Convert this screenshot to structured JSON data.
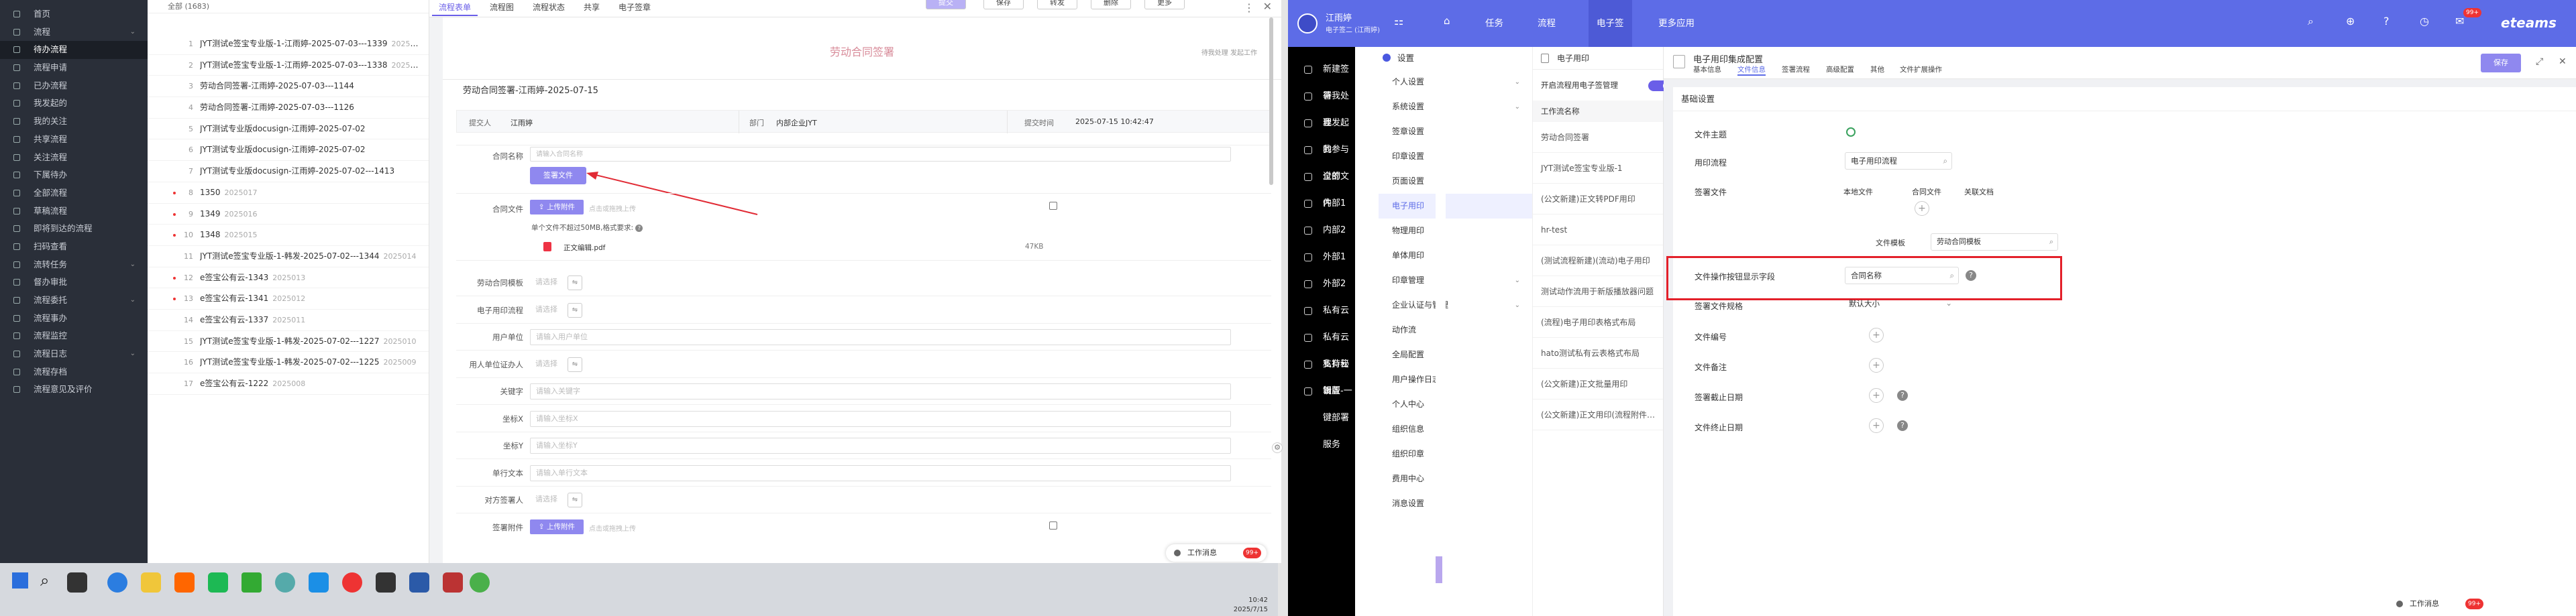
{
  "left_nav": {
    "items": [
      {
        "label": "首页",
        "active": false,
        "chev": false
      },
      {
        "label": "流程",
        "active": false,
        "chev": true
      },
      {
        "label": "待办流程",
        "active": true,
        "chev": false
      },
      {
        "label": "流程申请",
        "active": false,
        "chev": false
      },
      {
        "label": "已办流程",
        "active": false,
        "chev": false
      },
      {
        "label": "我发起的",
        "active": false,
        "chev": false
      },
      {
        "label": "我的关注",
        "active": false,
        "chev": false
      },
      {
        "label": "共享流程",
        "active": false,
        "chev": false
      },
      {
        "label": "关注流程",
        "active": false,
        "chev": false
      },
      {
        "label": "下属待办",
        "active": false,
        "chev": false
      },
      {
        "label": "全部流程",
        "active": false,
        "chev": false
      },
      {
        "label": "草稿流程",
        "active": false,
        "chev": false
      },
      {
        "label": "即将到达的流程",
        "active": false,
        "chev": false
      },
      {
        "label": "扫码查看",
        "active": false,
        "chev": false
      },
      {
        "label": "流转任务",
        "active": false,
        "chev": true
      },
      {
        "label": "督办审批",
        "active": false,
        "chev": false
      },
      {
        "label": "流程委托",
        "active": false,
        "chev": true
      },
      {
        "label": "流程事办",
        "active": false,
        "chev": false
      },
      {
        "label": "流程监控",
        "active": false,
        "chev": false
      },
      {
        "label": "流程日志",
        "active": false,
        "chev": true
      },
      {
        "label": "流程存档",
        "active": false,
        "chev": false
      },
      {
        "label": "流程意见及评价",
        "active": false,
        "chev": false
      }
    ]
  },
  "list": {
    "header": "全部 (1683)",
    "rows": [
      {
        "num": "1",
        "title": "JYT测试e签宝专业版-1-江雨婷-2025-07-03---1339",
        "tag": "2025018",
        "dot": false
      },
      {
        "num": "2",
        "title": "JYT测试e签宝专业版-1-江雨婷-2025-07-03---1338",
        "tag": "2025018",
        "dot": false
      },
      {
        "num": "3",
        "title": "劳动合同签署-江雨婷-2025-07-03---1144",
        "tag": "",
        "dot": false
      },
      {
        "num": "4",
        "title": "劳动合同签署-江雨婷-2025-07-03---1126",
        "tag": "",
        "dot": false
      },
      {
        "num": "5",
        "title": "JYT测试专业版docusign-江雨婷-2025-07-02",
        "tag": "",
        "dot": false
      },
      {
        "num": "6",
        "title": "JYT测试专业版docusign-江雨婷-2025-07-02",
        "tag": "",
        "dot": false
      },
      {
        "num": "7",
        "title": "JYT测试专业版docusign-江雨婷-2025-07-02---1413",
        "tag": "",
        "dot": false
      },
      {
        "num": "8",
        "title": "1350",
        "tag": "2025017",
        "dot": true
      },
      {
        "num": "9",
        "title": "1349",
        "tag": "2025016",
        "dot": true
      },
      {
        "num": "10",
        "title": "1348",
        "tag": "2025015",
        "dot": true
      },
      {
        "num": "11",
        "title": "JYT测试e签宝专业版-1-韩发-2025-07-02---1344",
        "tag": "2025014",
        "dot": false
      },
      {
        "num": "12",
        "title": "e签宝公有云-1343",
        "tag": "2025013",
        "dot": true
      },
      {
        "num": "13",
        "title": "e签宝公有云-1341",
        "tag": "2025012",
        "dot": true
      },
      {
        "num": "14",
        "title": "e签宝公有云-1337",
        "tag": "2025011",
        "dot": false
      },
      {
        "num": "15",
        "title": "JYT测试e签宝专业版-1-韩发-2025-07-02---1227",
        "tag": "2025010",
        "dot": false
      },
      {
        "num": "16",
        "title": "JYT测试e签宝专业版-1-韩发-2025-07-02---1225",
        "tag": "2025009",
        "dot": false
      },
      {
        "num": "17",
        "title": "e签宝公有云-1222",
        "tag": "2025008",
        "dot": false
      }
    ]
  },
  "form": {
    "tabs": [
      "流程表单",
      "流程图",
      "流程状态",
      "共享",
      "电子签章"
    ],
    "toolbar": [
      "提交",
      "保存",
      "转发",
      "删除",
      "更多"
    ],
    "main_title": "劳动合同签署",
    "sub_title": "劳动合同签署-江雨婷-2025-07-15",
    "link": "待我处理 发起工作",
    "row_labels": {
      "applicant": "提交人",
      "dept": "部门",
      "time": "提交时间"
    },
    "row_values": {
      "applicant": "江雨婷",
      "dept": "内部企业JYT",
      "time": "2025-07-15 10:42:47"
    },
    "contract_name_label": "合同名称",
    "contract_name_ph": "请输入合同名称",
    "sign_button": "签署文件",
    "contract_file_label": "合同文件",
    "upload_button": "上传附件",
    "upload_ph": "点击或拖拽上传",
    "file_limit": "单个文件不超过50MB,格式要求:",
    "file_name": "正文编辑.pdf",
    "file_size": "47KB",
    "fields": [
      {
        "label": "劳动合同模板",
        "ph": "请选择"
      },
      {
        "label": "电子用印流程",
        "ph": "请选择"
      },
      {
        "label": "用户单位",
        "ph": "请输入用户单位"
      },
      {
        "label": "用人单位证办人",
        "ph": "请选择"
      },
      {
        "label": "关键字",
        "ph": "请输入关键字"
      },
      {
        "label": "坐标X",
        "ph": "请输入坐标X"
      },
      {
        "label": "坐标Y",
        "ph": "请输入坐标Y"
      },
      {
        "label": "单行文本",
        "ph": "请输入单行文本"
      },
      {
        "label": "对方签署人",
        "ph": "请选择"
      },
      {
        "label": "签署附件",
        "ph": "点击或拖拽上传"
      }
    ],
    "work_msg": "工作消息",
    "badge": "99+"
  },
  "taskbar": {
    "time": "10:42",
    "date": "2025/7/15"
  },
  "app2": {
    "header": {
      "company": "江雨婷",
      "subtitle": "电子签二 (江雨婷)",
      "nav": [
        "任务",
        "流程",
        "电子签",
        "更多应用"
      ],
      "logo": "eteams",
      "badge": "99+"
    },
    "dark_menu": [
      "新建签署",
      "待我处理",
      "我发起的",
      "我参与过的",
      "全部文件",
      "内部1",
      "内部2",
      "外部1",
      "外部2",
      "私有云",
      "私有云支持秘钥",
      "私有云新版-一键部署服务",
      "设置"
    ],
    "settings_title": "设置",
    "settings_menu": [
      {
        "label": "个人设置",
        "chev": true
      },
      {
        "label": "系统设置",
        "chev": true
      },
      {
        "label": "签章设置",
        "chev": false
      },
      {
        "label": "印章设置",
        "chev": false
      },
      {
        "label": "页面设置",
        "chev": false
      },
      {
        "label": "电子用印",
        "chev": false,
        "active": true
      },
      {
        "label": "物理用印",
        "chev": false
      },
      {
        "label": "单体用印",
        "chev": false
      },
      {
        "label": "印章管理",
        "chev": true
      },
      {
        "label": "企业认证与管理",
        "chev": true
      },
      {
        "label": "动作流",
        "chev": false
      },
      {
        "label": "全局配置",
        "chev": false
      },
      {
        "label": "用户操作日志",
        "chev": false
      },
      {
        "label": "个人中心",
        "chev": false
      },
      {
        "label": "组织信息",
        "chev": false
      },
      {
        "label": "组织印章",
        "chev": false
      },
      {
        "label": "费用中心",
        "chev": false
      },
      {
        "label": "消息设置",
        "chev": false
      }
    ],
    "workflow_header": "电子用印",
    "toggle_label": "开启流程用电子签管理",
    "workflow_name_label": "工作流名称",
    "workflows": [
      "劳动合同签署",
      "JYT测试e签宝专业版-1",
      "(公文新建)正文转PDF用印",
      "hr-test",
      "(测试流程新建)(流动)电子用印",
      "测试动作流用于新版播放器问题",
      "(流程)电子用印表格式布局",
      "hato测试私有云表格式布局",
      "(公文新建)正文批量用印",
      "(公文新建)正文用印(流程附件转正文附件)"
    ],
    "config": {
      "title": "电子用印集成配置",
      "tabs": [
        "基本信息",
        "文件信息",
        "签署流程",
        "高级配置",
        "其他",
        "文件扩展操作"
      ],
      "save": "保存",
      "section": "基础设置",
      "file_subject_label": "文件主题",
      "flow_label": "用印流程",
      "flow_value": "电子用印流程",
      "sign_files_label": "签署文件",
      "sign_cols": [
        "本地文件",
        "合同文件",
        "关联文档"
      ],
      "file_template_label": "文件模板",
      "file_template_value": "劳动合同模板",
      "highlight_label": "文件操作按钮显示字段",
      "highlight_value": "合同名称",
      "spec_label": "签署文件规格",
      "spec_value": "默认大小",
      "rows": [
        "文件编号",
        "文件备注",
        "签署截止日期",
        "文件终止日期"
      ]
    },
    "work_msg": "工作消息",
    "badge": "99+"
  }
}
